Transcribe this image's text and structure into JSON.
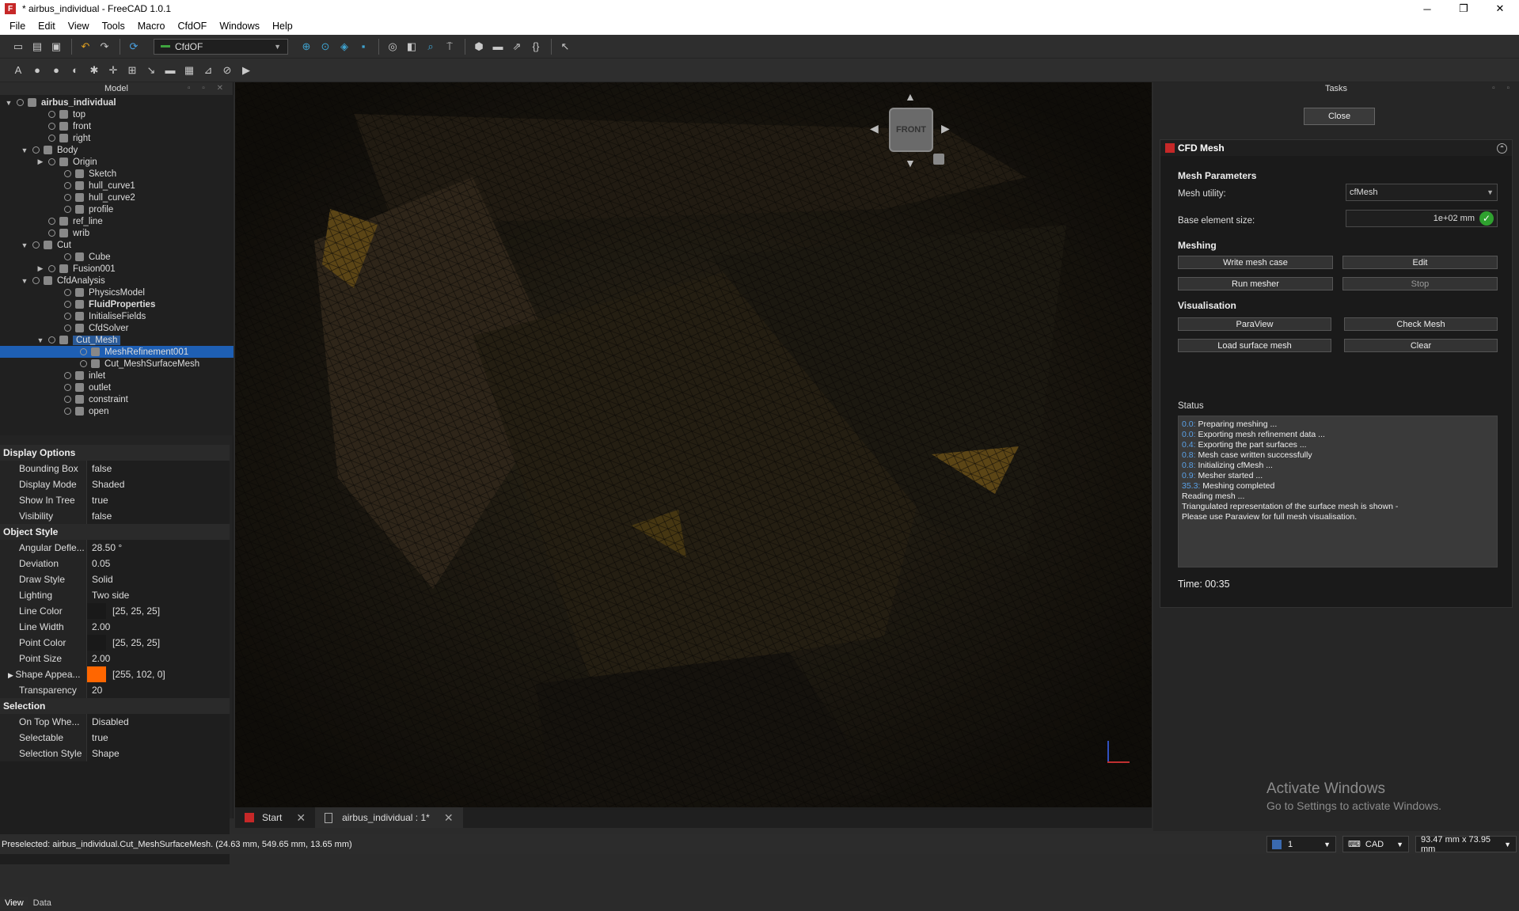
{
  "window": {
    "title": "* airbus_individual - FreeCAD 1.0.1"
  },
  "menu": [
    "File",
    "Edit",
    "View",
    "Tools",
    "Macro",
    "CfdOF",
    "Windows",
    "Help"
  ],
  "toolbar": {
    "workbench": "CfdOF"
  },
  "model_panel": {
    "title": "Model"
  },
  "tree": [
    {
      "label": "airbus_individual",
      "depth": 0,
      "exp": "▼",
      "bold": true
    },
    {
      "label": "top",
      "depth": 2
    },
    {
      "label": "front",
      "depth": 2
    },
    {
      "label": "right",
      "depth": 2
    },
    {
      "label": "Body",
      "depth": 1,
      "exp": "▼"
    },
    {
      "label": "Origin",
      "depth": 2,
      "exp": "▶"
    },
    {
      "label": "Sketch",
      "depth": 3
    },
    {
      "label": "hull_curve1",
      "depth": 3
    },
    {
      "label": "hull_curve2",
      "depth": 3
    },
    {
      "label": "profile",
      "depth": 3
    },
    {
      "label": "ref_line",
      "depth": 2
    },
    {
      "label": "wrib",
      "depth": 2
    },
    {
      "label": "Cut",
      "depth": 1,
      "exp": "▼"
    },
    {
      "label": "Cube",
      "depth": 3
    },
    {
      "label": "Fusion001",
      "depth": 2,
      "exp": "▶"
    },
    {
      "label": "CfdAnalysis",
      "depth": 1,
      "exp": "▼"
    },
    {
      "label": "PhysicsModel",
      "depth": 3
    },
    {
      "label": "FluidProperties",
      "depth": 3,
      "bold": true
    },
    {
      "label": "InitialiseFields",
      "depth": 3
    },
    {
      "label": "CfdSolver",
      "depth": 3
    },
    {
      "label": "Cut_Mesh",
      "depth": 2,
      "exp": "▼",
      "hl": true
    },
    {
      "label": "MeshRefinement001",
      "depth": 4,
      "sel": true
    },
    {
      "label": "Cut_MeshSurfaceMesh",
      "depth": 4
    },
    {
      "label": "inlet",
      "depth": 3
    },
    {
      "label": "outlet",
      "depth": 3
    },
    {
      "label": "constraint",
      "depth": 3
    },
    {
      "label": "open",
      "depth": 3
    }
  ],
  "properties": [
    {
      "group": "Display Options"
    },
    {
      "k": "Bounding Box",
      "v": "false"
    },
    {
      "k": "Display Mode",
      "v": "Shaded"
    },
    {
      "k": "Show In Tree",
      "v": "true"
    },
    {
      "k": "Visibility",
      "v": "false"
    },
    {
      "group": "Object Style"
    },
    {
      "k": "Angular Defle...",
      "v": "28.50 °"
    },
    {
      "k": "Deviation",
      "v": "0.05"
    },
    {
      "k": "Draw Style",
      "v": "Solid"
    },
    {
      "k": "Lighting",
      "v": "Two side"
    },
    {
      "k": "Line Color",
      "v": "[25, 25, 25]",
      "color": "#191919"
    },
    {
      "k": "Line Width",
      "v": "2.00"
    },
    {
      "k": "Point Color",
      "v": "[25, 25, 25]",
      "color": "#191919"
    },
    {
      "k": "Point Size",
      "v": "2.00"
    },
    {
      "k": "Shape Appea...",
      "v": "[255, 102, 0]",
      "color": "#ff6600",
      "exp": "▶"
    },
    {
      "k": "Transparency",
      "v": "20"
    },
    {
      "group": "Selection"
    },
    {
      "k": "On Top Whe...",
      "v": "Disabled"
    },
    {
      "k": "Selectable",
      "v": "true"
    },
    {
      "k": "Selection Style",
      "v": "Shape"
    }
  ],
  "bottom_tabs": [
    "View",
    "Data"
  ],
  "nav_cube": {
    "face": "FRONT"
  },
  "doc_tabs": {
    "start": "Start",
    "doc": "airbus_individual : 1*"
  },
  "tasks": {
    "title": "Tasks",
    "close": "Close",
    "panel_title": "CFD Mesh",
    "mesh_params": "Mesh Parameters",
    "mesh_utility_label": "Mesh utility:",
    "mesh_utility_value": "cfMesh",
    "base_size_label": "Base element size:",
    "base_size_value": "1e+02 mm",
    "meshing": "Meshing",
    "write_mesh_case": "Write mesh case",
    "edit": "Edit",
    "run_mesher": "Run mesher",
    "stop": "Stop",
    "visualisation": "Visualisation",
    "paraview": "ParaView",
    "check_mesh": "Check Mesh",
    "load_surface_mesh": "Load surface mesh",
    "clear": "Clear",
    "status_label": "Status",
    "status_lines": [
      {
        "t": "0.0:",
        "m": "Preparing meshing ..."
      },
      {
        "t": "0.0:",
        "m": "Exporting mesh refinement data ..."
      },
      {
        "t": "0.4:",
        "m": "Exporting the part surfaces ..."
      },
      {
        "t": "0.8:",
        "m": "Mesh case written successfully"
      },
      {
        "t": "0.8:",
        "m": "Initializing cfMesh ..."
      },
      {
        "t": "0.9:",
        "m": "Mesher started ..."
      },
      {
        "t": "35.3:",
        "m": "Meshing completed"
      },
      {
        "t": "",
        "m": "Reading mesh ..."
      },
      {
        "t": "",
        "m": "Triangulated representation of the surface mesh is shown -"
      },
      {
        "t": "",
        "m": "Please use Paraview for full mesh visualisation."
      }
    ],
    "time": "Time: 00:35"
  },
  "watermark": {
    "line1": "Activate Windows",
    "line2": "Go to Settings to activate Windows."
  },
  "statusbar": {
    "text": "Preselected: airbus_individual.Cut_MeshSurfaceMesh. (24.63 mm, 549.65 mm, 13.65 mm)",
    "page": "1",
    "nav": "CAD",
    "dims": "93.47 mm x 73.95 mm"
  }
}
